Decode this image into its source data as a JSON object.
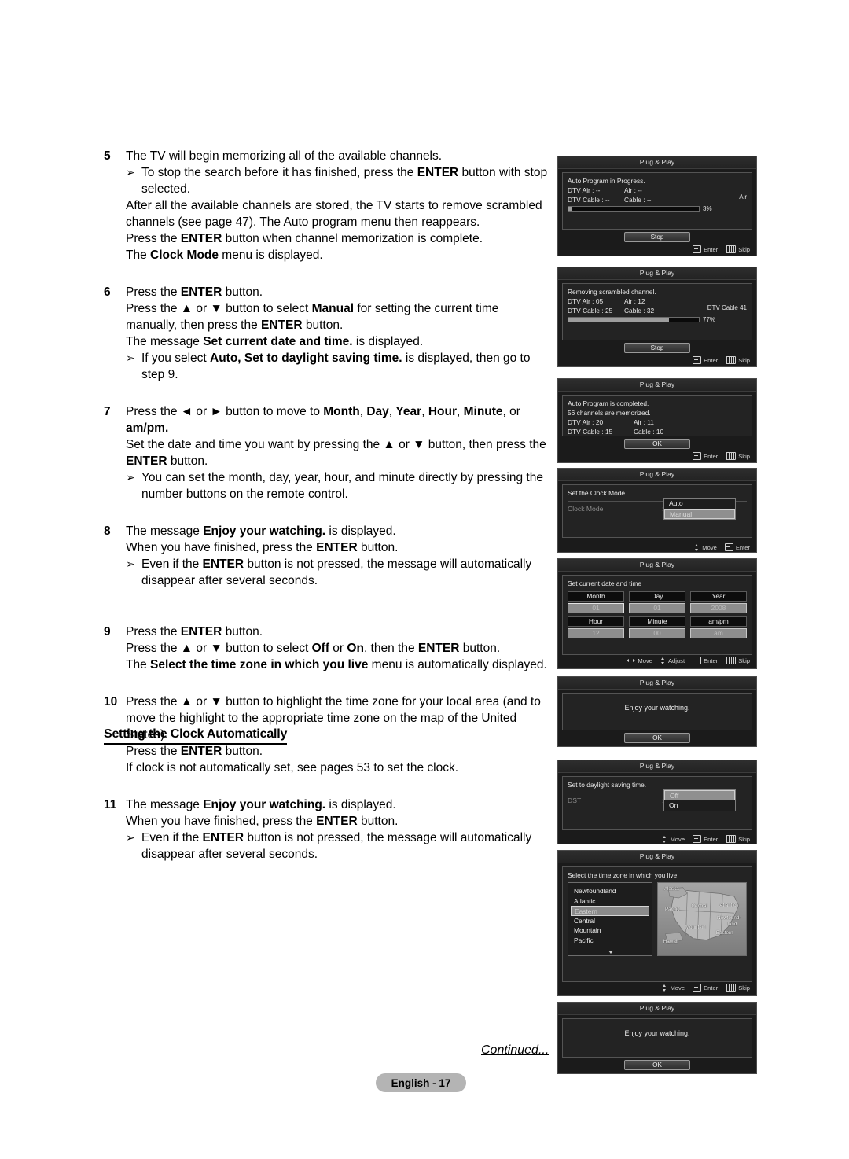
{
  "document": {
    "page_label": "English - 17",
    "continued": "Continued...",
    "section_heading": "Setting the Clock Automatically"
  },
  "steps": [
    {
      "num": "5",
      "lines": [
        {
          "type": "plain",
          "parts": [
            {
              "t": "The TV will begin memorizing all of the available channels."
            }
          ]
        },
        {
          "type": "bullet",
          "parts": [
            {
              "t": "To stop the search before it has finished, press the "
            },
            {
              "t": "ENTER",
              "b": true
            },
            {
              "t": " button with stop selected."
            }
          ]
        },
        {
          "type": "plain",
          "parts": [
            {
              "t": "After all the available channels are stored, the TV starts to remove scrambled channels (see page 47). The Auto program menu then reappears."
            }
          ]
        },
        {
          "type": "plain",
          "parts": [
            {
              "t": "Press the "
            },
            {
              "t": "ENTER",
              "b": true
            },
            {
              "t": " button when channel memorization is complete."
            }
          ]
        },
        {
          "type": "plain",
          "parts": [
            {
              "t": "The "
            },
            {
              "t": "Clock Mode",
              "b": true
            },
            {
              "t": " menu is displayed."
            }
          ]
        }
      ]
    },
    {
      "num": "6",
      "lines": [
        {
          "type": "plain",
          "parts": [
            {
              "t": "Press the "
            },
            {
              "t": "ENTER",
              "b": true
            },
            {
              "t": " button."
            }
          ]
        },
        {
          "type": "plain",
          "parts": [
            {
              "t": "Press the ▲ or ▼ button to select "
            },
            {
              "t": "Manual",
              "b": true
            },
            {
              "t": " for setting the current time manually, then press the "
            },
            {
              "t": "ENTER",
              "b": true
            },
            {
              "t": " button."
            }
          ]
        },
        {
          "type": "plain",
          "parts": [
            {
              "t": "The message "
            },
            {
              "t": "Set current date and time.",
              "b": true
            },
            {
              "t": " is displayed."
            }
          ]
        },
        {
          "type": "bullet",
          "parts": [
            {
              "t": "If you select "
            },
            {
              "t": "Auto, Set to daylight saving time.",
              "b": true
            },
            {
              "t": " is displayed, then go to step 9."
            }
          ]
        }
      ]
    },
    {
      "num": "7",
      "lines": [
        {
          "type": "plain",
          "parts": [
            {
              "t": "Press the ◄ or ► button to move to "
            },
            {
              "t": "Month",
              "b": true
            },
            {
              "t": ", "
            },
            {
              "t": "Day",
              "b": true
            },
            {
              "t": ", "
            },
            {
              "t": "Year",
              "b": true
            },
            {
              "t": ", "
            },
            {
              "t": "Hour",
              "b": true
            },
            {
              "t": ", "
            },
            {
              "t": "Minute",
              "b": true
            },
            {
              "t": ", or "
            },
            {
              "t": "am/pm.",
              "b": true
            }
          ]
        },
        {
          "type": "plain",
          "parts": [
            {
              "t": "Set the date and time you want by pressing the ▲ or ▼ button, then press the "
            },
            {
              "t": "ENTER",
              "b": true
            },
            {
              "t": " button."
            }
          ]
        },
        {
          "type": "bullet",
          "parts": [
            {
              "t": "You can set the month, day, year, hour, and minute directly by pressing the number buttons on the remote control."
            }
          ]
        }
      ]
    },
    {
      "num": "8",
      "lines": [
        {
          "type": "plain",
          "parts": [
            {
              "t": "The message "
            },
            {
              "t": "Enjoy your watching.",
              "b": true
            },
            {
              "t": " is displayed."
            }
          ]
        },
        {
          "type": "plain",
          "parts": [
            {
              "t": "When you have finished, press the "
            },
            {
              "t": "ENTER",
              "b": true
            },
            {
              "t": " button."
            }
          ]
        },
        {
          "type": "bullet",
          "parts": [
            {
              "t": "Even if the "
            },
            {
              "t": "ENTER",
              "b": true
            },
            {
              "t": " button is not pressed, the message will automatically disappear after several seconds."
            }
          ]
        }
      ]
    },
    {
      "num": "9",
      "lines": [
        {
          "type": "plain",
          "parts": [
            {
              "t": "Press the "
            },
            {
              "t": "ENTER",
              "b": true
            },
            {
              "t": " button."
            }
          ]
        },
        {
          "type": "plain",
          "parts": [
            {
              "t": "Press the ▲ or ▼ button to select "
            },
            {
              "t": "Off",
              "b": true
            },
            {
              "t": " or "
            },
            {
              "t": "On",
              "b": true
            },
            {
              "t": ", then the "
            },
            {
              "t": "ENTER",
              "b": true
            },
            {
              "t": " button."
            }
          ]
        },
        {
          "type": "plain",
          "parts": [
            {
              "t": "The "
            },
            {
              "t": "Select the time zone in which you live",
              "b": true
            },
            {
              "t": " menu is automatically displayed."
            }
          ]
        }
      ]
    },
    {
      "num": "10",
      "lines": [
        {
          "type": "plain",
          "parts": [
            {
              "t": "Press the ▲ or ▼ button to highlight the time zone for your local area (and to move the highlight to the appropriate time zone on the map of the United States)."
            }
          ]
        },
        {
          "type": "plain",
          "parts": [
            {
              "t": "Press the "
            },
            {
              "t": "ENTER",
              "b": true
            },
            {
              "t": " button."
            }
          ]
        },
        {
          "type": "plain",
          "parts": [
            {
              "t": "If clock is not automatically set, see pages 53 to set the clock."
            }
          ]
        }
      ]
    },
    {
      "num": "11",
      "lines": [
        {
          "type": "plain",
          "parts": [
            {
              "t": "The message "
            },
            {
              "t": "Enjoy your watching.",
              "b": true
            },
            {
              "t": " is displayed."
            }
          ]
        },
        {
          "type": "plain",
          "parts": [
            {
              "t": "When you have finished, press the "
            },
            {
              "t": "ENTER",
              "b": true
            },
            {
              "t": " button."
            }
          ]
        },
        {
          "type": "bullet",
          "parts": [
            {
              "t": "Even if the "
            },
            {
              "t": "ENTER",
              "b": true
            },
            {
              "t": " button is not pressed, the message will automatically disappear after several seconds."
            }
          ]
        }
      ]
    }
  ],
  "osd_common": {
    "title": "Plug & Play",
    "hint_enter": "Enter",
    "hint_skip": "Skip",
    "hint_move": "Move",
    "hint_adjust": "Adjust",
    "btn_stop": "Stop",
    "btn_ok": "OK"
  },
  "panels": {
    "auto_program_progress": {
      "message": "Auto Program in Progress.",
      "dtv_air_label": "DTV Air : --",
      "air_label": "Air : --",
      "dtv_cable_label": "DTV Cable : --",
      "cable_label": "Cable : --",
      "right_label": "Air",
      "percent_label": "3%",
      "percent": 3
    },
    "removing_scrambled": {
      "message": "Removing scrambled channel.",
      "dtv_air_label": "DTV Air : 05",
      "air_label": "Air : 12",
      "dtv_cable_label": "DTV Cable : 25",
      "cable_label": "Cable : 32",
      "right_label": "DTV Cable 41",
      "percent_label": "77%",
      "percent": 77
    },
    "auto_program_complete": {
      "message_1": "Auto Program is completed.",
      "message_2": "56 channels are memorized.",
      "dtv_air_label": "DTV Air : 20",
      "air_label": "Air : 11",
      "dtv_cable_label": "DTV Cable : 15",
      "cable_label": "Cable : 10"
    },
    "clock_mode": {
      "message": "Set the Clock Mode.",
      "field_label": "Clock Mode",
      "options": [
        "Auto",
        "Manual"
      ],
      "selected": "Manual"
    },
    "set_date_time": {
      "message": "Set current date and time",
      "fields": [
        {
          "label": "Month",
          "value": "01",
          "active": true
        },
        {
          "label": "Day",
          "value": "01",
          "active": false
        },
        {
          "label": "Year",
          "value": "2008",
          "active": false
        },
        {
          "label": "Hour",
          "value": "12",
          "active": false
        },
        {
          "label": "Minute",
          "value": "00",
          "active": false
        },
        {
          "label": "am/pm",
          "value": "am",
          "active": false
        }
      ]
    },
    "enjoy_watching_1": {
      "message": "Enjoy your watching."
    },
    "dst": {
      "message": "Set to daylight saving time.",
      "field_label": "DST",
      "options": [
        "Off",
        "On"
      ],
      "selected": "Off"
    },
    "time_zone": {
      "message": "Select the time zone in which you live.",
      "items": [
        "Newfoundland",
        "Atlantic",
        "Eastern",
        "Central",
        "Mountain",
        "Pacific"
      ],
      "selected": "Eastern",
      "map_labels": [
        "Alaska",
        "Pacific",
        "Central",
        "Atlantic",
        "Newfound-",
        "land",
        "Mountain",
        "Eastern",
        "Hawaii"
      ]
    },
    "enjoy_watching_2": {
      "message": "Enjoy your watching."
    }
  },
  "colors": {
    "osd_bg": "#1b1b1b",
    "osd_border": "#4a4a4a",
    "highlight": "#8d8d8d",
    "badge_bg": "#b4b4b4"
  }
}
